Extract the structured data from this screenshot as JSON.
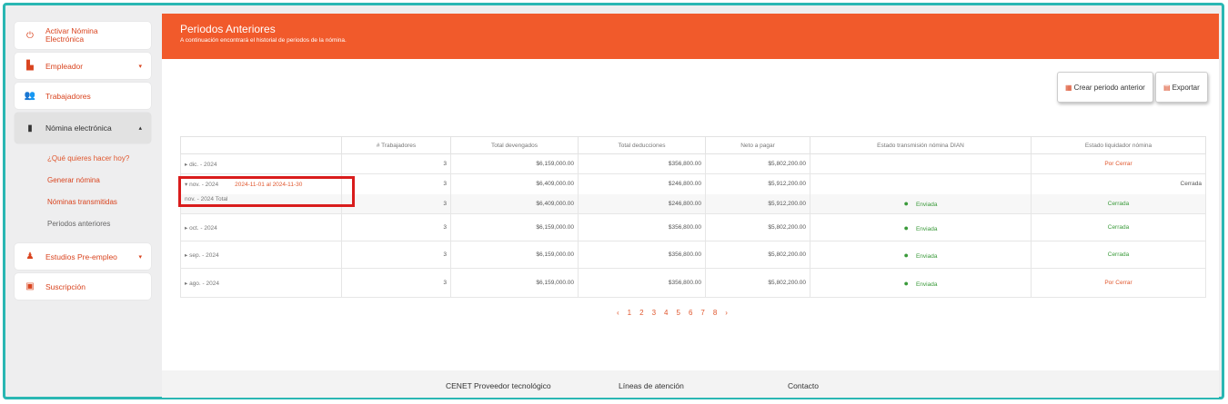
{
  "sidebar": {
    "items": [
      {
        "label": "Activar Nómina Electrónica",
        "icon": "power-icon"
      },
      {
        "label": "Empleador",
        "icon": "building-icon",
        "chevron": "▾"
      },
      {
        "label": "Trabajadores",
        "icon": "users-icon"
      },
      {
        "label": "Nómina electrónica",
        "icon": "document-icon",
        "chevron": "▴"
      },
      {
        "label": "Estudios Pre-empleo",
        "icon": "person-icon",
        "chevron": "▾"
      },
      {
        "label": "Suscripción",
        "icon": "card-icon"
      }
    ],
    "subitems": [
      "¿Qué quieres hacer hoy?",
      "Generar nómina",
      "Nóminas transmitidas",
      "Periodos anteriores"
    ]
  },
  "banner": {
    "title": "Periodos Anteriores",
    "subtitle": "A continuación encontrará el historial de periodos de la nómina."
  },
  "buttons": {
    "create": "Crear periodo anterior",
    "export": "Exportar"
  },
  "table": {
    "headers": [
      "",
      "# Trabajadores",
      "Total devengados",
      "Total deducciones",
      "Neto a pagar",
      "Estado transmisión nómina DIAN",
      "Estado liquidador nómina"
    ],
    "rows": [
      {
        "period": "dic. - 2024",
        "workers": "3",
        "devengados": "$6,159,000.00",
        "deducciones": "$356,800.00",
        "neto": "$5,802,200.00",
        "dian": "",
        "liquidador": "Por Cerrar"
      },
      {
        "period": "nov. - 2024",
        "range": "2024-11-01 al 2024-11-30",
        "workers": "3",
        "devengados": "$6,409,000.00",
        "deducciones": "$246,800.00",
        "neto": "$5,912,200.00",
        "dian": "",
        "liquidador": "Cerrada"
      },
      {
        "period": "nov. - 2024 Total",
        "workers": "3",
        "devengados": "$6,409,000.00",
        "deducciones": "$246,800.00",
        "neto": "$5,912,200.00",
        "dian": "Enviada",
        "liquidador": "Cerrada"
      },
      {
        "period": "oct. - 2024",
        "workers": "3",
        "devengados": "$6,159,000.00",
        "deducciones": "$356,800.00",
        "neto": "$5,802,200.00",
        "dian": "Enviada",
        "liquidador": "Cerrada"
      },
      {
        "period": "sep. - 2024",
        "workers": "3",
        "devengados": "$6,159,000.00",
        "deducciones": "$356,800.00",
        "neto": "$5,802,200.00",
        "dian": "Enviada",
        "liquidador": "Cerrada"
      },
      {
        "period": "ago. - 2024",
        "workers": "3",
        "devengados": "$6,159,000.00",
        "deducciones": "$356,800.00",
        "neto": "$5,802,200.00",
        "dian": "Enviada",
        "liquidador": "Por Cerrar"
      }
    ]
  },
  "pagination": {
    "prev": "‹",
    "pages": [
      "1",
      "2",
      "3",
      "4",
      "5",
      "6",
      "7",
      "8"
    ],
    "next": "›"
  },
  "footer": {
    "provider": "CENET Proveedor tecnológico",
    "hours": "Líneas de atención",
    "contact": "Contacto"
  },
  "colors": {
    "accent": "#f15a2b",
    "frame": "#2ab7b3",
    "success": "#3a9a3a",
    "highlight": "#d91c1c"
  }
}
